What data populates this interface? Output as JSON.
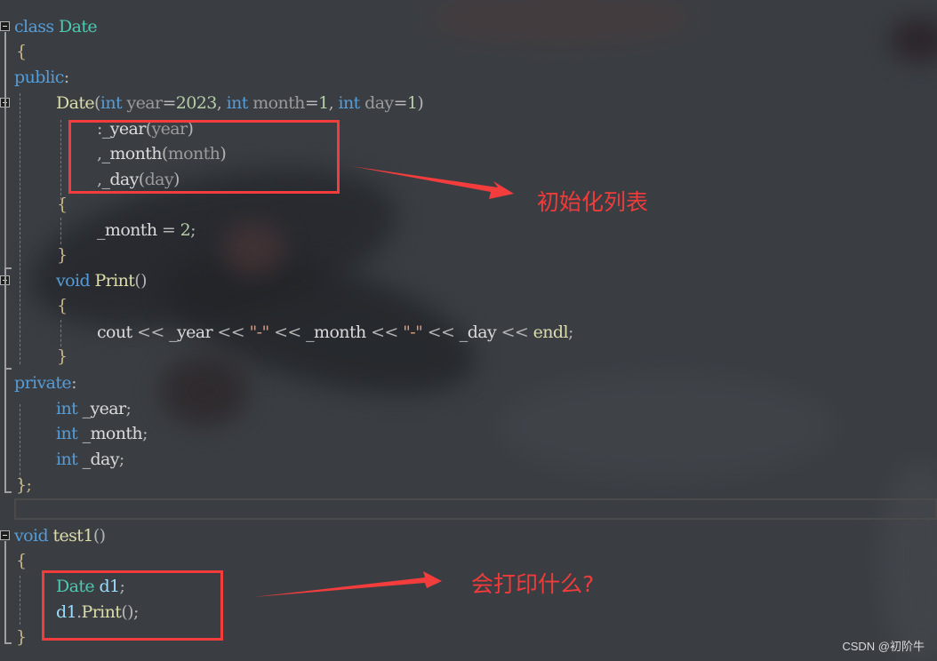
{
  "editor": {
    "language": "C++",
    "lines": {
      "l1": {
        "kw": "class",
        "type": "Date"
      },
      "l2": {
        "text": "{"
      },
      "l3": {
        "kw": "public",
        "punct": ":"
      },
      "l4": {
        "fn": "Date",
        "open": "(",
        "t1": "int",
        "p1": " year",
        "eq1": "=",
        "v1": "2023",
        "c1": ", ",
        "t2": "int",
        "p2": " month",
        "eq2": "=",
        "v2": "1",
        "c2": ", ",
        "t3": "int",
        "p3": " day",
        "eq3": "=",
        "v3": "1",
        "close": ")"
      },
      "l5": {
        "lead": ":",
        "member": "_year",
        "open": "(",
        "arg": "year",
        "close": ")"
      },
      "l6": {
        "lead": ",",
        "member": "_month",
        "open": "(",
        "arg": "month",
        "close": ")"
      },
      "l7": {
        "lead": ",",
        "member": "_day",
        "open": "(",
        "arg": "day",
        "close": ")"
      },
      "l8": {
        "text": "{"
      },
      "l9": {
        "member": "_month",
        "op": " = ",
        "val": "2",
        "end": ";"
      },
      "l10": {
        "text": "}"
      },
      "l11": {
        "kw": "void",
        "fn": "Print",
        "parens": "()"
      },
      "l12": {
        "text": "{"
      },
      "l13": {
        "id1": "cout",
        "op": " << ",
        "m1": "_year",
        "s1": "\"-\"",
        "m2": "_month",
        "s2": "\"-\"",
        "m3": "_day",
        "fn": "endl",
        "end": ";"
      },
      "l14": {
        "text": "}"
      },
      "l15": {
        "kw": "private",
        "punct": ":"
      },
      "l16": {
        "kw": "int",
        "member": " _year",
        "end": ";"
      },
      "l17": {
        "kw": "int",
        "member": " _month",
        "end": ";"
      },
      "l18": {
        "kw": "int",
        "member": " _day",
        "end": ";"
      },
      "l19": {
        "text": "};"
      },
      "l21": {
        "kw": "void",
        "fn": "test1",
        "parens": "()"
      },
      "l22": {
        "text": "{"
      },
      "l23": {
        "type": "Date",
        "var": " d1",
        "end": ";"
      },
      "l24": {
        "var": "d1",
        "dot": ".",
        "fn": "Print",
        "parens": "()",
        "end": ";"
      },
      "l25": {
        "text": "}"
      }
    }
  },
  "annotations": {
    "init_list_label": "初始化列表",
    "question_label": "会打印什么?",
    "color": "#f03b3b"
  },
  "watermark": "CSDN @初阶牛"
}
